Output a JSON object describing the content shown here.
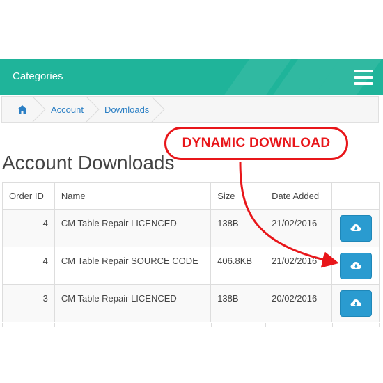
{
  "header": {
    "title": "Categories",
    "menu_icon": "hamburger-icon",
    "accent": "#1fb49a"
  },
  "breadcrumb": {
    "home_icon": "home-icon",
    "items": [
      "Account",
      "Downloads"
    ]
  },
  "page": {
    "title": "Account Downloads"
  },
  "table": {
    "columns": [
      "Order ID",
      "Name",
      "Size",
      "Date Added"
    ],
    "rows": [
      {
        "order_id": "4",
        "name": "CM Table Repair LICENCED",
        "size": "138B",
        "date": "21/02/2016"
      },
      {
        "order_id": "4",
        "name": "CM Table Repair SOURCE CODE",
        "size": "406.8KB",
        "date": "21/02/2016"
      },
      {
        "order_id": "3",
        "name": "CM Table Repair LICENCED",
        "size": "138B",
        "date": "20/02/2016"
      }
    ],
    "button_icon": "cloud-download-icon",
    "button_color": "#2a9bd0"
  },
  "annotation": {
    "label": "DYNAMIC DOWNLOAD",
    "color": "#e8161a"
  }
}
